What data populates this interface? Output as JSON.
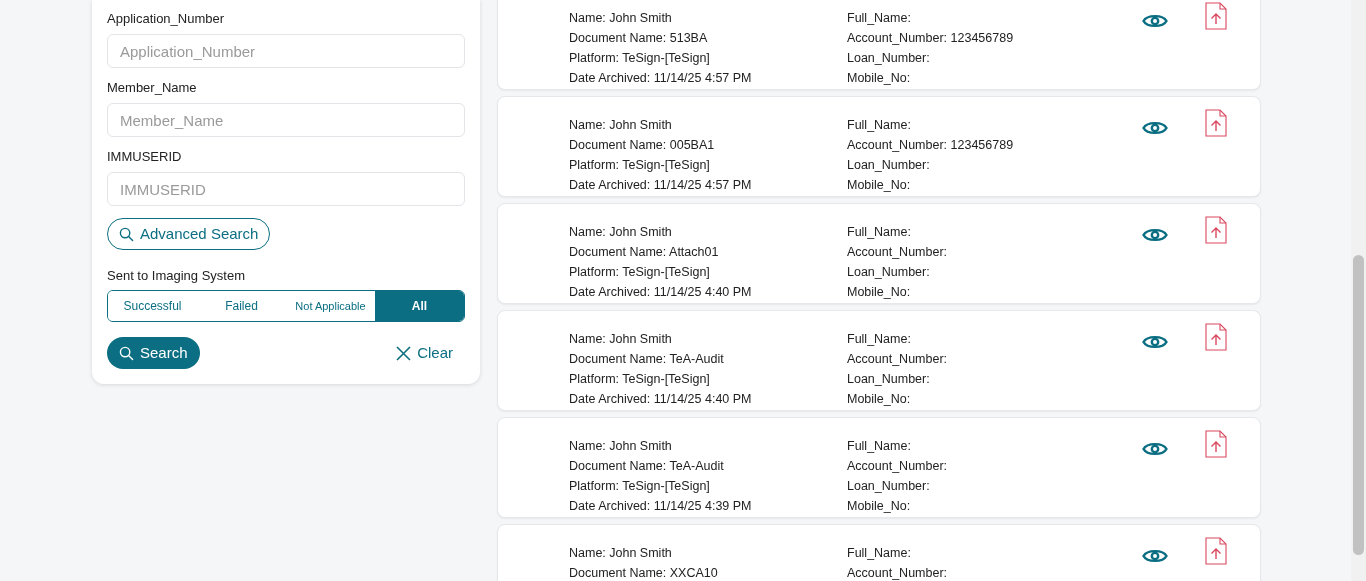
{
  "filters": [
    {
      "label": "Application_Number",
      "placeholder": "Application_Number"
    },
    {
      "label": "Member_Name",
      "placeholder": "Member_Name"
    },
    {
      "label": "IMMUSERID",
      "placeholder": "IMMUSERID"
    }
  ],
  "advanced_search": "Advanced Search",
  "imaging": {
    "label": "Sent to Imaging System",
    "options": [
      {
        "label": "Successful",
        "selected": false
      },
      {
        "label": "Failed",
        "selected": false
      },
      {
        "label": "Not Applicable",
        "selected": false
      },
      {
        "label": "All",
        "selected": true
      }
    ]
  },
  "search_button": "Search",
  "clear_button": "Clear",
  "results": [
    {
      "left": [
        "Name: John Smith",
        "Document Name: 513BA",
        "Platform: TeSign-[TeSign]",
        "Date Archived: 11/14/25 4:57 PM"
      ],
      "right": [
        "Full_Name:",
        "Account_Number: 123456789",
        "Loan_Number:",
        "Mobile_No:"
      ]
    },
    {
      "left": [
        "Name: John Smith",
        "Document Name: 005BA1",
        "Platform: TeSign-[TeSign]",
        "Date Archived: 11/14/25 4:57 PM"
      ],
      "right": [
        "Full_Name:",
        "Account_Number: 123456789",
        "Loan_Number:",
        "Mobile_No:"
      ]
    },
    {
      "left": [
        "Name: John Smith",
        "Document Name: Attach01",
        "Platform: TeSign-[TeSign]",
        "Date Archived: 11/14/25 4:40 PM"
      ],
      "right": [
        "Full_Name:",
        "Account_Number:",
        "Loan_Number:",
        "Mobile_No:"
      ]
    },
    {
      "left": [
        "Name: John Smith",
        "Document Name: TeA-Audit",
        "Platform: TeSign-[TeSign]",
        "Date Archived: 11/14/25 4:40 PM"
      ],
      "right": [
        "Full_Name:",
        "Account_Number:",
        "Loan_Number:",
        "Mobile_No:"
      ]
    },
    {
      "left": [
        "Name: John Smith",
        "Document Name: TeA-Audit",
        "Platform: TeSign-[TeSign]",
        "Date Archived: 11/14/25 4:39 PM"
      ],
      "right": [
        "Full_Name:",
        "Account_Number:",
        "Loan_Number:",
        "Mobile_No:"
      ]
    },
    {
      "left": [
        "Name: John Smith",
        "Document Name: XXCA10"
      ],
      "right": [
        "Full_Name:",
        "Account_Number:"
      ]
    }
  ]
}
